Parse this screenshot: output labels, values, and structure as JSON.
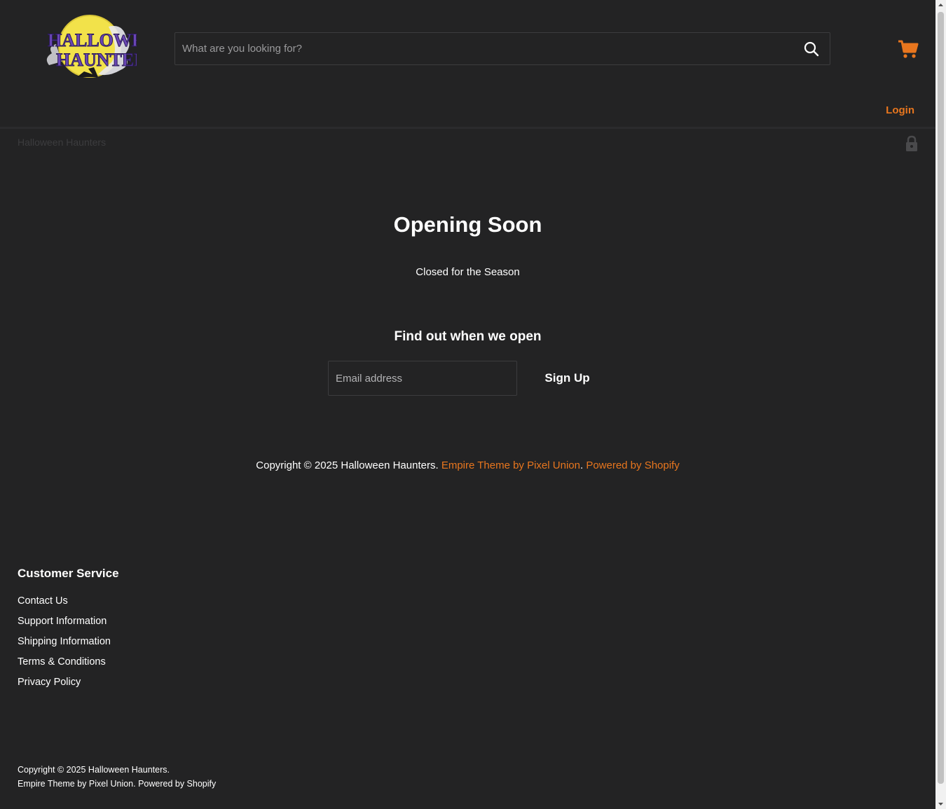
{
  "header": {
    "logo_alt": "Halloween Haunters",
    "logo_line1": "HALLOWEEN",
    "logo_line2": "HAUNTERS",
    "search_placeholder": "What are you looking for?",
    "search_icon": "search-icon",
    "cart_icon": "cart-icon",
    "login_label": "Login",
    "accent_color": "#e8761e"
  },
  "password_bar": {
    "store_name": "Halloween Haunters",
    "lock_icon": "lock-icon"
  },
  "main": {
    "title": "Opening Soon",
    "subtitle": "Closed for the Season",
    "signup_heading": "Find out when we open",
    "email_placeholder": "Email address",
    "signup_button": "Sign Up",
    "copyright_text": "Copyright © 2025 Halloween Haunters.",
    "theme_link": "Empire Theme by Pixel Union",
    "separator": ".",
    "powered_link": "Powered by Shopify"
  },
  "footer": {
    "heading": "Customer Service",
    "links": [
      "Contact Us",
      "Support Information",
      "Shipping Information",
      "Terms & Conditions",
      "Privacy Policy"
    ],
    "copyright": "Copyright © 2025 Halloween Haunters.",
    "theme_link": "Empire Theme by Pixel Union",
    "powered_link": "Powered by Shopify"
  },
  "colors": {
    "background": "#232324",
    "accent": "#e8761e",
    "text": "#ffffff"
  }
}
